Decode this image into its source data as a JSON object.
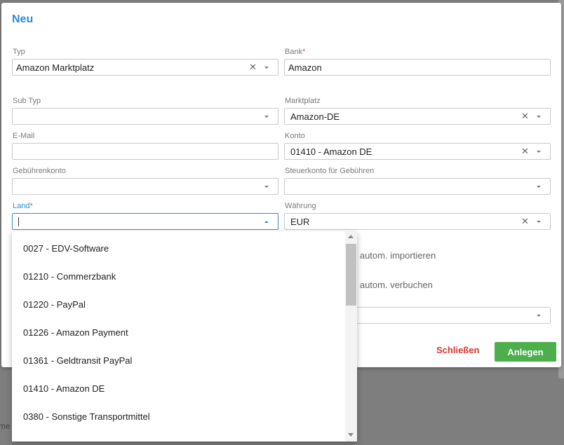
{
  "dialog": {
    "title": "Neu",
    "fields": {
      "typ": {
        "label": "Typ",
        "value": "Amazon Marktplatz"
      },
      "bank": {
        "label": "Bank",
        "required_mark": "*",
        "value": "Amazon"
      },
      "sub_typ": {
        "label": "Sub Typ",
        "value": ""
      },
      "marktplatz": {
        "label": "Marktplatz",
        "value": "Amazon-DE"
      },
      "email": {
        "label": "E-Mail",
        "value": ""
      },
      "konto": {
        "label": "Konto",
        "value": "01410 - Amazon DE"
      },
      "gebuehrenkonto": {
        "label": "Gebührenkonto",
        "value": ""
      },
      "steuerkonto": {
        "label": "Steuerkonto für Gebühren",
        "value": ""
      },
      "land": {
        "label": "Land",
        "required_mark": "*",
        "value": ""
      },
      "waehrung": {
        "label": "Währung",
        "value": "EUR"
      }
    },
    "checkbox_texts": [
      "n autom. importieren",
      "n autom. verbuchen"
    ],
    "buttons": {
      "close": "Schließen",
      "create": "Anlegen"
    },
    "colors": {
      "accent": "#2b8ed6",
      "create": "#4cae4c",
      "close": "#d9352f"
    }
  },
  "dropdown": {
    "items": [
      "0027 - EDV-Software",
      "01210 - Commerzbank",
      "01220 - PayPal",
      "01226 - Amazon Payment",
      "01361 - Geldtransit PayPal",
      "01410 - Amazon DE",
      "0380 - Sonstige Transportmittel"
    ]
  },
  "background": {
    "fragment_text": "me"
  }
}
